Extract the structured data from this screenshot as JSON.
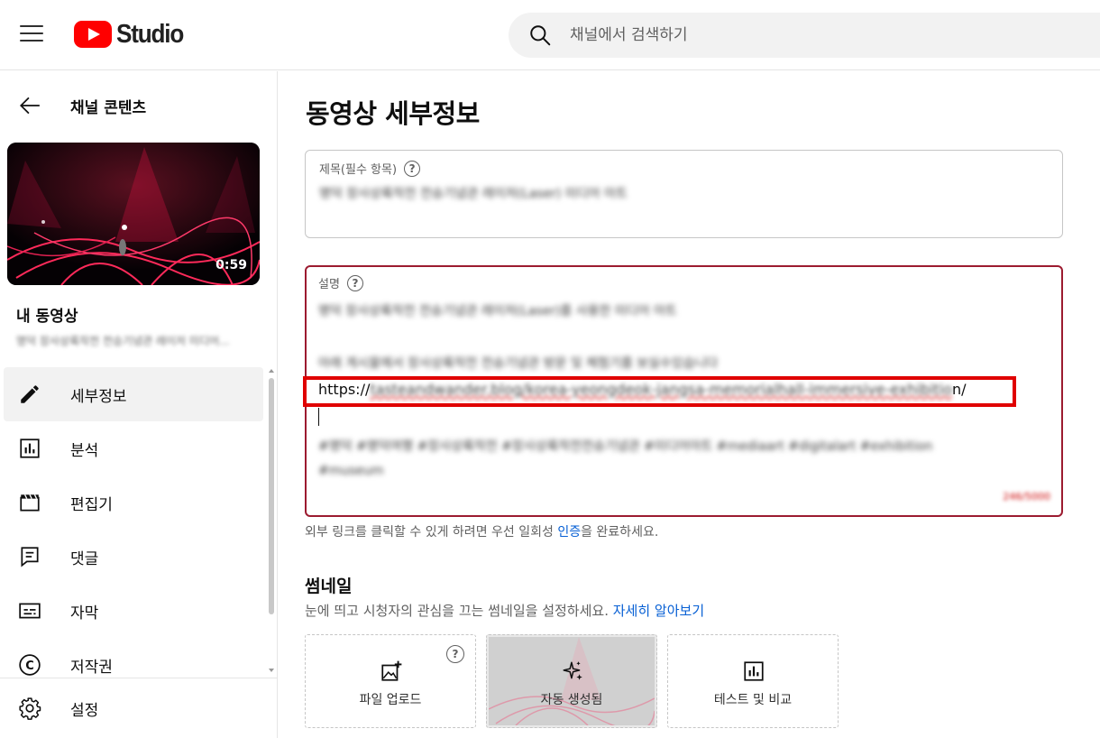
{
  "header": {
    "logo_text": "Studio",
    "search_placeholder": "채널에서 검색하기"
  },
  "sidebar": {
    "back_label": "채널 콘텐츠",
    "thumbnail_duration": "0:59",
    "my_video_label": "내 동영상",
    "video_subtitle": "명덕 장사상륙작전 전승기념관 레이저 미디어...",
    "items": [
      {
        "label": "세부정보",
        "icon": "pencil-icon",
        "active": true
      },
      {
        "label": "분석",
        "icon": "analytics-icon",
        "active": false
      },
      {
        "label": "편집기",
        "icon": "clapperboard-icon",
        "active": false
      },
      {
        "label": "댓글",
        "icon": "comment-icon",
        "active": false
      },
      {
        "label": "자막",
        "icon": "subtitles-icon",
        "active": false
      },
      {
        "label": "저작권",
        "icon": "copyright-icon",
        "active": false
      }
    ],
    "settings_label": "설정"
  },
  "main": {
    "page_title": "동영상 세부정보",
    "title_field": {
      "label": "제목(필수 항목)",
      "value": "명덕 장사상륙작전 전승기념관  레이저(Laser) 미디어 아트"
    },
    "description_field": {
      "label": "설명",
      "line1": "명덕 장사상륙작전 전승기념관 레이저(Laser)를 사용한 미디어 아트",
      "line2": "아래 게시물에서 장사상륙작전 전승기념관 방문 및 체험기를 보실수있습니다",
      "url_prefix": "https://",
      "url_body": "tasteandwander.blog/korea-yeongdeok-jangsa-memorialhall-immersive-exhibitio",
      "url_suffix": "n/",
      "hashtags1": "#명덕 #명덕여행 #장사상륙작전 #장사상륙작전전승기념관 #미디어아트 #mediaart #digitalart #exhibition",
      "hashtags2": "#museum",
      "counter": "246/5000"
    },
    "link_note_before": "외부 링크를 클릭할 수 있게 하려면 우선 일회성 ",
    "link_note_link": "인증",
    "link_note_after": "을 완료하세요.",
    "thumbnail_heading": "썸네일",
    "thumbnail_desc": "눈에 띄고 시청자의 관심을 끄는 썸네일을 설정하세요. ",
    "thumbnail_learn_more": "자세히 알아보기",
    "tiles": [
      {
        "label": "파일 업로드",
        "icon": "image-add-icon"
      },
      {
        "label": "자동 생성됨",
        "icon": "sparkle-icon"
      },
      {
        "label": "테스트 및 비교",
        "icon": "analytics-icon"
      }
    ]
  },
  "colors": {
    "brand_red": "#ff0000",
    "desc_border": "#9c1b30",
    "highlight_red": "#e00000",
    "link_blue": "#065fd4"
  }
}
